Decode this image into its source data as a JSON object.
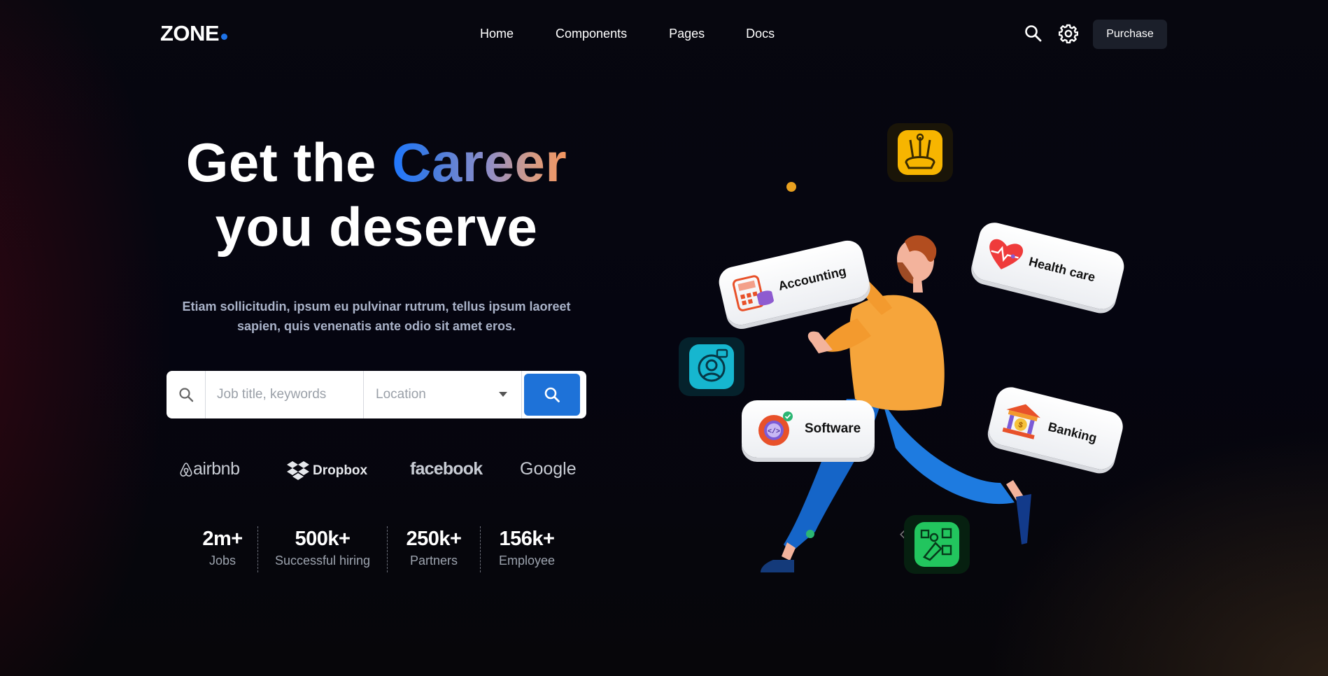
{
  "nav": {
    "logo": "ZONE",
    "menu": [
      "Home",
      "Components",
      "Pages",
      "Docs"
    ],
    "purchase_label": "Purchase"
  },
  "hero": {
    "headline_part1": "Get the ",
    "headline_highlight": "Career",
    "headline_part2": "you deserve",
    "subtitle": "Etiam sollicitudin, ipsum eu pulvinar rutrum, tellus ipsum laoreet sapien, quis venenatis ante odio sit amet eros."
  },
  "search": {
    "keywords_placeholder": "Job title, keywords",
    "location_placeholder": "Location"
  },
  "brands": [
    "airbnb",
    "Dropbox",
    "facebook",
    "Google"
  ],
  "stats": [
    {
      "value": "2m+",
      "label": "Jobs"
    },
    {
      "value": "500k+",
      "label": "Successful hiring"
    },
    {
      "value": "250k+",
      "label": "Partners"
    },
    {
      "value": "156k+",
      "label": "Employee"
    }
  ],
  "categories": [
    "Accounting",
    "Health care",
    "Software",
    "Banking"
  ],
  "colors": {
    "accent": "#1e72d8",
    "background": "#06060e",
    "purchase_bg": "#1b1f2a"
  },
  "icons": [
    "search-icon",
    "gear-icon",
    "chevron-down-icon",
    "pencil-cup-icon",
    "support-icon",
    "rocket-icon"
  ]
}
